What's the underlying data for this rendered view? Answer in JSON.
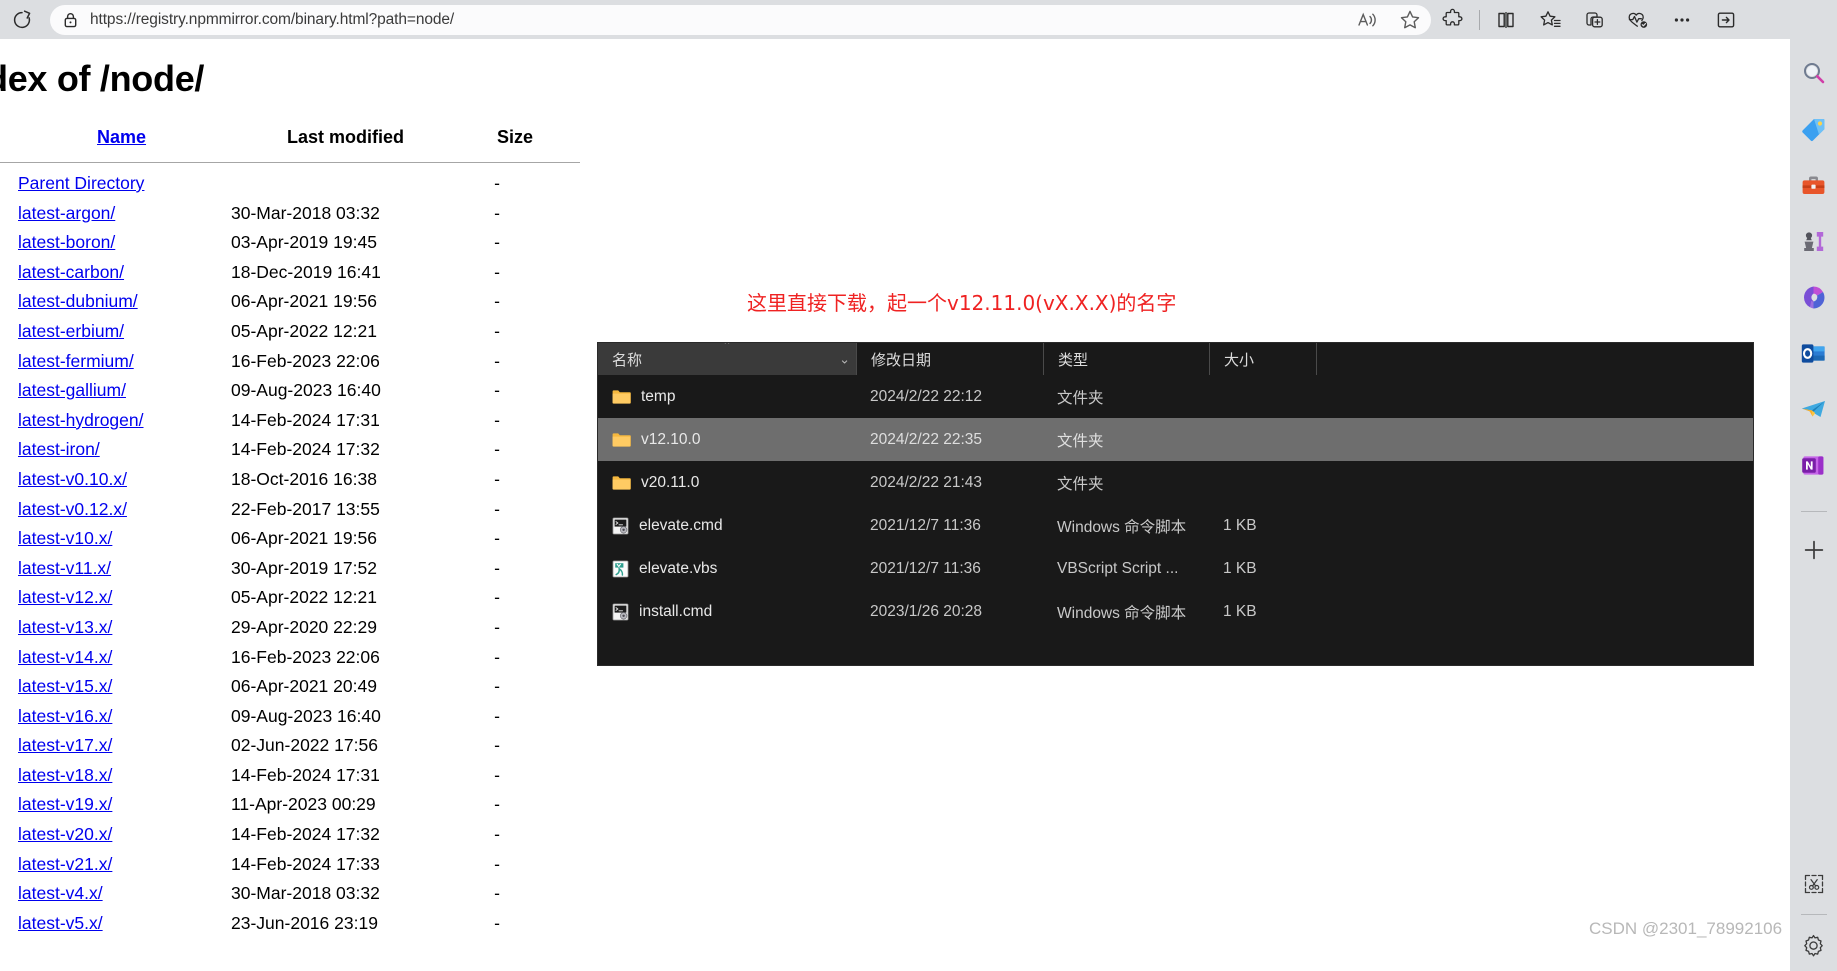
{
  "browser": {
    "reload_label": "Refresh",
    "url_prefix": "https://",
    "url_domain": "registry.npmmirror.com",
    "url_path": "/binary.html?path=node/",
    "url_full": "https://registry.npmmirror.com/binary.html?path=node/",
    "toolbar": {
      "read_aloud": "Read aloud",
      "favorite": "Add this page to favorites",
      "extensions": "Extensions",
      "split_screen": "Split screen",
      "collections": "Collections",
      "add_tab_group": "Add to new group",
      "browser_essentials": "Browser essentials",
      "settings_more": "Settings and more",
      "sidebar_toggle": "Sidebar"
    }
  },
  "page": {
    "title": "dex of /node/",
    "columns": {
      "name": "Name",
      "last_modified": "Last modified",
      "size": "Size"
    },
    "rows": [
      {
        "name": "Parent Directory",
        "modified": "",
        "size": "-"
      },
      {
        "name": "latest-argon/",
        "modified": "30-Mar-2018 03:32",
        "size": "-"
      },
      {
        "name": "latest-boron/",
        "modified": "03-Apr-2019 19:45",
        "size": "-"
      },
      {
        "name": "latest-carbon/",
        "modified": "18-Dec-2019 16:41",
        "size": "-"
      },
      {
        "name": "latest-dubnium/",
        "modified": "06-Apr-2021 19:56",
        "size": "-"
      },
      {
        "name": "latest-erbium/",
        "modified": "05-Apr-2022 12:21",
        "size": "-"
      },
      {
        "name": "latest-fermium/",
        "modified": "16-Feb-2023 22:06",
        "size": "-"
      },
      {
        "name": "latest-gallium/",
        "modified": "09-Aug-2023 16:40",
        "size": "-"
      },
      {
        "name": "latest-hydrogen/",
        "modified": "14-Feb-2024 17:31",
        "size": "-"
      },
      {
        "name": "latest-iron/",
        "modified": "14-Feb-2024 17:32",
        "size": "-"
      },
      {
        "name": "latest-v0.10.x/",
        "modified": "18-Oct-2016 16:38",
        "size": "-"
      },
      {
        "name": "latest-v0.12.x/",
        "modified": "22-Feb-2017 13:55",
        "size": "-"
      },
      {
        "name": "latest-v10.x/",
        "modified": "06-Apr-2021 19:56",
        "size": "-"
      },
      {
        "name": "latest-v11.x/",
        "modified": "30-Apr-2019 17:52",
        "size": "-"
      },
      {
        "name": "latest-v12.x/",
        "modified": "05-Apr-2022 12:21",
        "size": "-"
      },
      {
        "name": "latest-v13.x/",
        "modified": "29-Apr-2020 22:29",
        "size": "-"
      },
      {
        "name": "latest-v14.x/",
        "modified": "16-Feb-2023 22:06",
        "size": "-"
      },
      {
        "name": "latest-v15.x/",
        "modified": "06-Apr-2021 20:49",
        "size": "-"
      },
      {
        "name": "latest-v16.x/",
        "modified": "09-Aug-2023 16:40",
        "size": "-"
      },
      {
        "name": "latest-v17.x/",
        "modified": "02-Jun-2022 17:56",
        "size": "-"
      },
      {
        "name": "latest-v18.x/",
        "modified": "14-Feb-2024 17:31",
        "size": "-"
      },
      {
        "name": "latest-v19.x/",
        "modified": "11-Apr-2023 00:29",
        "size": "-"
      },
      {
        "name": "latest-v20.x/",
        "modified": "14-Feb-2024 17:32",
        "size": "-"
      },
      {
        "name": "latest-v21.x/",
        "modified": "14-Feb-2024 17:33",
        "size": "-"
      },
      {
        "name": "latest-v4.x/",
        "modified": "30-Mar-2018 03:32",
        "size": "-"
      },
      {
        "name": "latest-v5.x/",
        "modified": "23-Jun-2016 23:19",
        "size": "-"
      }
    ]
  },
  "annotation": {
    "text": "这里直接下载，起一个v12.11.0(vX.X.X)的名字",
    "color": "#ef2222"
  },
  "explorer": {
    "columns": [
      {
        "label": "名称",
        "key": "name"
      },
      {
        "label": "修改日期",
        "key": "date"
      },
      {
        "label": "类型",
        "key": "type"
      },
      {
        "label": "大小",
        "key": "size"
      }
    ],
    "sort_caret": "⌃",
    "dropdown_caret": "⌄",
    "rows": [
      {
        "name": "temp",
        "date": "2024/2/22 22:12",
        "type": "文件夹",
        "size": "",
        "icon": "folder-icon",
        "selected": false
      },
      {
        "name": "v12.10.0",
        "date": "2024/2/22 22:35",
        "type": "文件夹",
        "size": "",
        "icon": "folder-icon",
        "selected": true
      },
      {
        "name": "v20.11.0",
        "date": "2024/2/22 21:43",
        "type": "文件夹",
        "size": "",
        "icon": "folder-icon",
        "selected": false
      },
      {
        "name": "elevate.cmd",
        "date": "2021/12/7 11:36",
        "type": "Windows 命令脚本",
        "size": "1 KB",
        "icon": "cmd-script-icon",
        "selected": false
      },
      {
        "name": "elevate.vbs",
        "date": "2021/12/7 11:36",
        "type": "VBScript Script ...",
        "size": "1 KB",
        "icon": "vbs-script-icon",
        "selected": false
      },
      {
        "name": "install.cmd",
        "date": "2023/1/26 20:28",
        "type": "Windows 命令脚本",
        "size": "1 KB",
        "icon": "cmd-script-icon",
        "selected": false
      }
    ]
  },
  "sidebar": {
    "items": [
      {
        "name": "search-icon",
        "label": "Search"
      },
      {
        "name": "shopping-tag-icon",
        "label": "Shopping"
      },
      {
        "name": "tools-briefcase-icon",
        "label": "Tools"
      },
      {
        "name": "games-chess-icon",
        "label": "Games"
      },
      {
        "name": "microsoft-365-icon",
        "label": "Microsoft 365"
      },
      {
        "name": "outlook-icon",
        "label": "Outlook"
      },
      {
        "name": "telegram-icon",
        "label": "Telegram"
      },
      {
        "name": "onenote-icon",
        "label": "OneNote"
      }
    ],
    "add_label": "Customize",
    "bottom": [
      {
        "name": "screenshot-scissors-icon",
        "label": "Screenshot"
      },
      {
        "name": "gear-icon",
        "label": "Sidebar settings"
      }
    ]
  },
  "watermark": {
    "text": "CSDN @2301_78992106"
  }
}
